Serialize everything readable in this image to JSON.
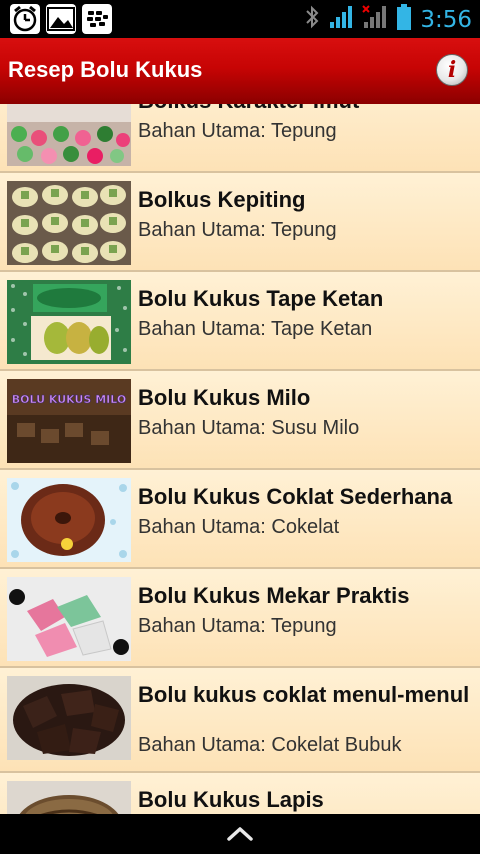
{
  "status_bar": {
    "time": "3:56",
    "left_icons": [
      "alarm-icon",
      "gallery-icon",
      "bbm-icon"
    ],
    "right_icons": [
      "bluetooth-icon",
      "signal-icon",
      "no-signal-icon",
      "battery-icon"
    ],
    "clock_color": "#33b5e5"
  },
  "action_bar": {
    "title": "Resep Bolu Kukus",
    "info_label": "i",
    "color": "#c70404"
  },
  "recipes": [
    {
      "title": "Bolkus Karakter Imut",
      "subtitle": "Bahan Utama: Tepung"
    },
    {
      "title": "Bolkus Kepiting",
      "subtitle": "Bahan Utama: Tepung"
    },
    {
      "title": "Bolu Kukus Tape Ketan",
      "subtitle": "Bahan Utama: Tape Ketan"
    },
    {
      "title": "Bolu Kukus Milo",
      "subtitle": "Bahan Utama: Susu Milo"
    },
    {
      "title": "Bolu Kukus Coklat Sederhana",
      "subtitle": "Bahan Utama: Cokelat"
    },
    {
      "title": "Bolu Kukus Mekar Praktis",
      "subtitle": "Bahan Utama: Tepung"
    },
    {
      "title": "Bolu kukus coklat menul-menul",
      "subtitle": "Bahan Utama: Cokelat Bubuk"
    },
    {
      "title": "Bolu Kukus Lapis",
      "subtitle": ""
    }
  ],
  "thumb_overlays": {
    "milo": "BOLU KUKUS MILO"
  }
}
